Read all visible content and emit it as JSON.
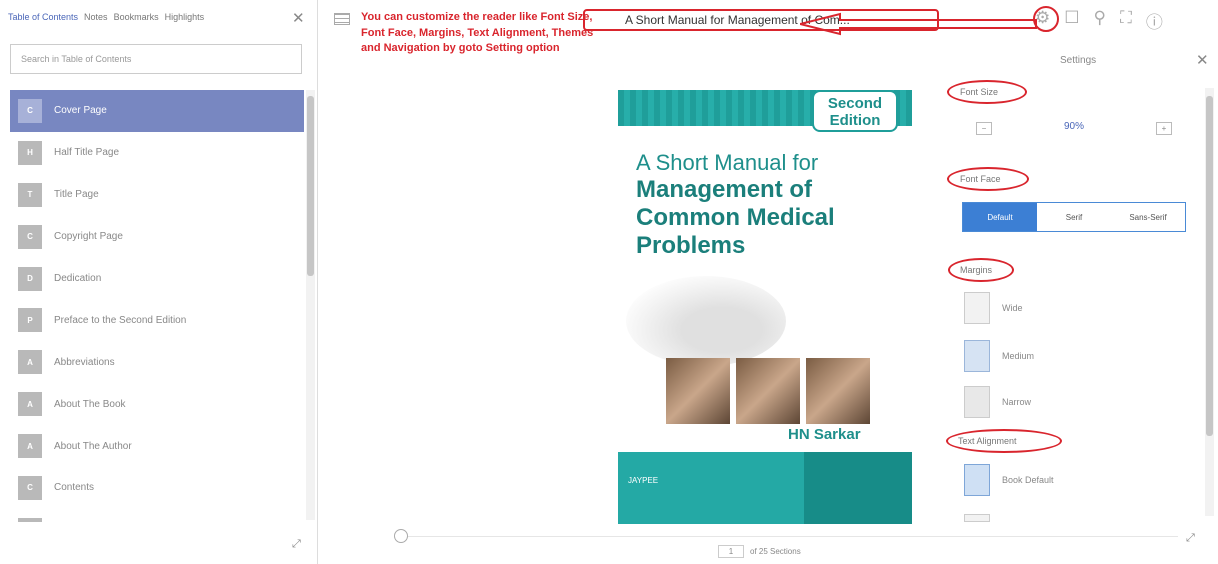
{
  "left_panel": {
    "tabs": [
      "Table of Contents",
      "Notes",
      "Bookmarks",
      "Highlights"
    ],
    "close_glyph": "✕",
    "search_placeholder": "Search in Table of Contents",
    "toc_items": [
      {
        "badge": "C",
        "label": "Cover Page",
        "active": true
      },
      {
        "badge": "H",
        "label": "Half Title Page"
      },
      {
        "badge": "T",
        "label": "Title Page"
      },
      {
        "badge": "C",
        "label": "Copyright Page"
      },
      {
        "badge": "D",
        "label": "Dedication"
      },
      {
        "badge": "P",
        "label": "Preface to the Second Edition"
      },
      {
        "badge": "A",
        "label": "Abbreviations"
      },
      {
        "badge": "A",
        "label": "About The Book"
      },
      {
        "badge": "A",
        "label": "About The Author"
      },
      {
        "badge": "C",
        "label": "Contents"
      },
      {
        "badge": "",
        "label": ""
      }
    ],
    "resize_glyph": "⤢"
  },
  "annotation": {
    "text": "You can customize the reader like Font Size, Font Face, Margins, Text Alignment, Themes and Navigation by goto Setting option"
  },
  "header": {
    "book_title": "A Short Manual for Management of Com...",
    "icons": [
      "settings-icon",
      "share-icon",
      "search-icon",
      "fullscreen-icon",
      "info-icon"
    ]
  },
  "cover": {
    "edition_line1": "Second",
    "edition_line2": "Edition",
    "title_line1": "A Short Manual for",
    "title_line2": "Management of",
    "title_line3": "Common Medical",
    "title_line4": "Problems",
    "author": "HN Sarkar",
    "publisher": "JAYPEE"
  },
  "settings": {
    "title": "Settings",
    "font_size_label": "Font Size",
    "font_size_value": "90%",
    "decrease": "−",
    "increase": "+",
    "font_face_label": "Font Face",
    "font_faces": [
      "Default",
      "Serif",
      "Sans-Serif"
    ],
    "margins_label": "Margins",
    "margins": [
      "Wide",
      "Medium",
      "Narrow"
    ],
    "text_alignment_label": "Text Alignment",
    "alignments": [
      "Book Default"
    ]
  },
  "footer": {
    "current_page": "1",
    "page_suffix": "of 25 Sections"
  },
  "colors": {
    "accent": "#d9252d",
    "selected": "#7887c1",
    "cover_teal": "#1f9e9a"
  }
}
